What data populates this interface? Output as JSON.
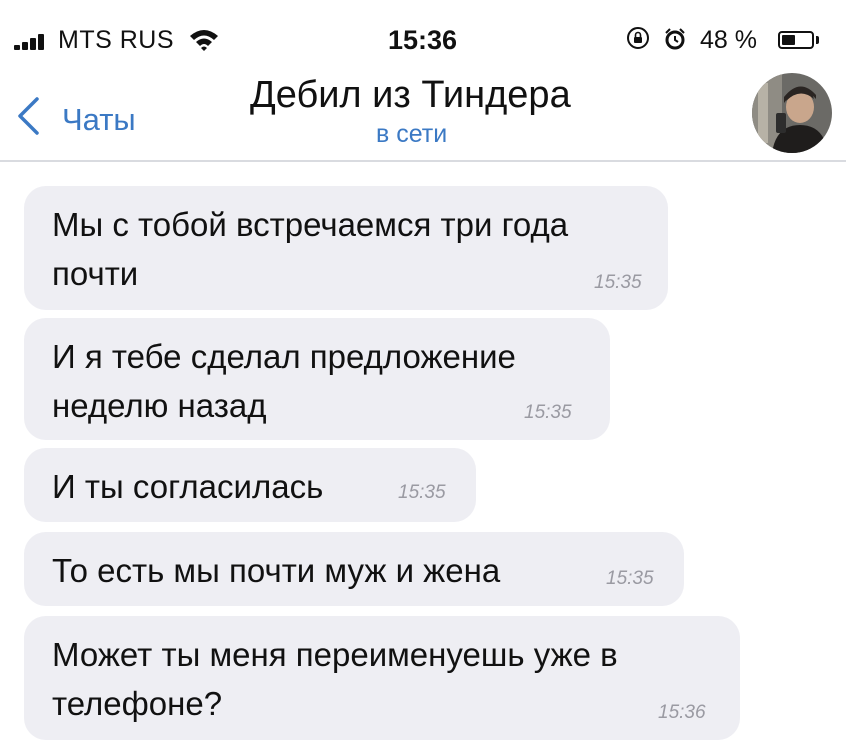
{
  "status_bar": {
    "carrier": "MTS RUS",
    "time": "15:36",
    "battery_percent": "48 %",
    "battery_level": 0.48,
    "icons": [
      "signal-icon",
      "wifi-icon",
      "rotation-lock-icon",
      "alarm-icon",
      "battery-icon"
    ]
  },
  "nav": {
    "back_label": "Чаты",
    "title": "Дебил из Тиндера",
    "status": "в сети",
    "accent_color": "#3b79c4"
  },
  "messages": [
    {
      "text": "Мы с тобой встречаемся три года почти",
      "time": "15:35"
    },
    {
      "text": "И я тебе сделал предложение неделю назад",
      "time": "15:35"
    },
    {
      "text": "И ты согласилась",
      "time": "15:35"
    },
    {
      "text": "То есть мы почти муж и жена",
      "time": "15:35"
    },
    {
      "text": "Может ты меня переименуешь уже в телефоне?",
      "time": "15:36"
    }
  ],
  "colors": {
    "bubble_background": "#eeeef3",
    "timestamp": "#9a9aa2"
  }
}
